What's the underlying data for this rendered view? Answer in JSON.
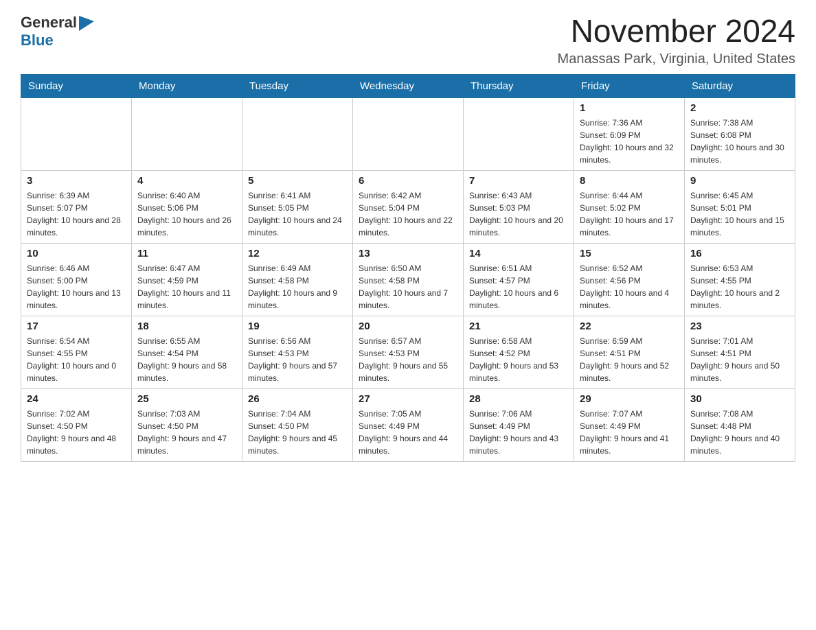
{
  "logo": {
    "general": "General",
    "blue": "Blue"
  },
  "header": {
    "month": "November 2024",
    "location": "Manassas Park, Virginia, United States"
  },
  "weekdays": [
    "Sunday",
    "Monday",
    "Tuesday",
    "Wednesday",
    "Thursday",
    "Friday",
    "Saturday"
  ],
  "weeks": [
    [
      {
        "day": "",
        "sunrise": "",
        "sunset": "",
        "daylight": ""
      },
      {
        "day": "",
        "sunrise": "",
        "sunset": "",
        "daylight": ""
      },
      {
        "day": "",
        "sunrise": "",
        "sunset": "",
        "daylight": ""
      },
      {
        "day": "",
        "sunrise": "",
        "sunset": "",
        "daylight": ""
      },
      {
        "day": "",
        "sunrise": "",
        "sunset": "",
        "daylight": ""
      },
      {
        "day": "1",
        "sunrise": "Sunrise: 7:36 AM",
        "sunset": "Sunset: 6:09 PM",
        "daylight": "Daylight: 10 hours and 32 minutes."
      },
      {
        "day": "2",
        "sunrise": "Sunrise: 7:38 AM",
        "sunset": "Sunset: 6:08 PM",
        "daylight": "Daylight: 10 hours and 30 minutes."
      }
    ],
    [
      {
        "day": "3",
        "sunrise": "Sunrise: 6:39 AM",
        "sunset": "Sunset: 5:07 PM",
        "daylight": "Daylight: 10 hours and 28 minutes."
      },
      {
        "day": "4",
        "sunrise": "Sunrise: 6:40 AM",
        "sunset": "Sunset: 5:06 PM",
        "daylight": "Daylight: 10 hours and 26 minutes."
      },
      {
        "day": "5",
        "sunrise": "Sunrise: 6:41 AM",
        "sunset": "Sunset: 5:05 PM",
        "daylight": "Daylight: 10 hours and 24 minutes."
      },
      {
        "day": "6",
        "sunrise": "Sunrise: 6:42 AM",
        "sunset": "Sunset: 5:04 PM",
        "daylight": "Daylight: 10 hours and 22 minutes."
      },
      {
        "day": "7",
        "sunrise": "Sunrise: 6:43 AM",
        "sunset": "Sunset: 5:03 PM",
        "daylight": "Daylight: 10 hours and 20 minutes."
      },
      {
        "day": "8",
        "sunrise": "Sunrise: 6:44 AM",
        "sunset": "Sunset: 5:02 PM",
        "daylight": "Daylight: 10 hours and 17 minutes."
      },
      {
        "day": "9",
        "sunrise": "Sunrise: 6:45 AM",
        "sunset": "Sunset: 5:01 PM",
        "daylight": "Daylight: 10 hours and 15 minutes."
      }
    ],
    [
      {
        "day": "10",
        "sunrise": "Sunrise: 6:46 AM",
        "sunset": "Sunset: 5:00 PM",
        "daylight": "Daylight: 10 hours and 13 minutes."
      },
      {
        "day": "11",
        "sunrise": "Sunrise: 6:47 AM",
        "sunset": "Sunset: 4:59 PM",
        "daylight": "Daylight: 10 hours and 11 minutes."
      },
      {
        "day": "12",
        "sunrise": "Sunrise: 6:49 AM",
        "sunset": "Sunset: 4:58 PM",
        "daylight": "Daylight: 10 hours and 9 minutes."
      },
      {
        "day": "13",
        "sunrise": "Sunrise: 6:50 AM",
        "sunset": "Sunset: 4:58 PM",
        "daylight": "Daylight: 10 hours and 7 minutes."
      },
      {
        "day": "14",
        "sunrise": "Sunrise: 6:51 AM",
        "sunset": "Sunset: 4:57 PM",
        "daylight": "Daylight: 10 hours and 6 minutes."
      },
      {
        "day": "15",
        "sunrise": "Sunrise: 6:52 AM",
        "sunset": "Sunset: 4:56 PM",
        "daylight": "Daylight: 10 hours and 4 minutes."
      },
      {
        "day": "16",
        "sunrise": "Sunrise: 6:53 AM",
        "sunset": "Sunset: 4:55 PM",
        "daylight": "Daylight: 10 hours and 2 minutes."
      }
    ],
    [
      {
        "day": "17",
        "sunrise": "Sunrise: 6:54 AM",
        "sunset": "Sunset: 4:55 PM",
        "daylight": "Daylight: 10 hours and 0 minutes."
      },
      {
        "day": "18",
        "sunrise": "Sunrise: 6:55 AM",
        "sunset": "Sunset: 4:54 PM",
        "daylight": "Daylight: 9 hours and 58 minutes."
      },
      {
        "day": "19",
        "sunrise": "Sunrise: 6:56 AM",
        "sunset": "Sunset: 4:53 PM",
        "daylight": "Daylight: 9 hours and 57 minutes."
      },
      {
        "day": "20",
        "sunrise": "Sunrise: 6:57 AM",
        "sunset": "Sunset: 4:53 PM",
        "daylight": "Daylight: 9 hours and 55 minutes."
      },
      {
        "day": "21",
        "sunrise": "Sunrise: 6:58 AM",
        "sunset": "Sunset: 4:52 PM",
        "daylight": "Daylight: 9 hours and 53 minutes."
      },
      {
        "day": "22",
        "sunrise": "Sunrise: 6:59 AM",
        "sunset": "Sunset: 4:51 PM",
        "daylight": "Daylight: 9 hours and 52 minutes."
      },
      {
        "day": "23",
        "sunrise": "Sunrise: 7:01 AM",
        "sunset": "Sunset: 4:51 PM",
        "daylight": "Daylight: 9 hours and 50 minutes."
      }
    ],
    [
      {
        "day": "24",
        "sunrise": "Sunrise: 7:02 AM",
        "sunset": "Sunset: 4:50 PM",
        "daylight": "Daylight: 9 hours and 48 minutes."
      },
      {
        "day": "25",
        "sunrise": "Sunrise: 7:03 AM",
        "sunset": "Sunset: 4:50 PM",
        "daylight": "Daylight: 9 hours and 47 minutes."
      },
      {
        "day": "26",
        "sunrise": "Sunrise: 7:04 AM",
        "sunset": "Sunset: 4:50 PM",
        "daylight": "Daylight: 9 hours and 45 minutes."
      },
      {
        "day": "27",
        "sunrise": "Sunrise: 7:05 AM",
        "sunset": "Sunset: 4:49 PM",
        "daylight": "Daylight: 9 hours and 44 minutes."
      },
      {
        "day": "28",
        "sunrise": "Sunrise: 7:06 AM",
        "sunset": "Sunset: 4:49 PM",
        "daylight": "Daylight: 9 hours and 43 minutes."
      },
      {
        "day": "29",
        "sunrise": "Sunrise: 7:07 AM",
        "sunset": "Sunset: 4:49 PM",
        "daylight": "Daylight: 9 hours and 41 minutes."
      },
      {
        "day": "30",
        "sunrise": "Sunrise: 7:08 AM",
        "sunset": "Sunset: 4:48 PM",
        "daylight": "Daylight: 9 hours and 40 minutes."
      }
    ]
  ]
}
